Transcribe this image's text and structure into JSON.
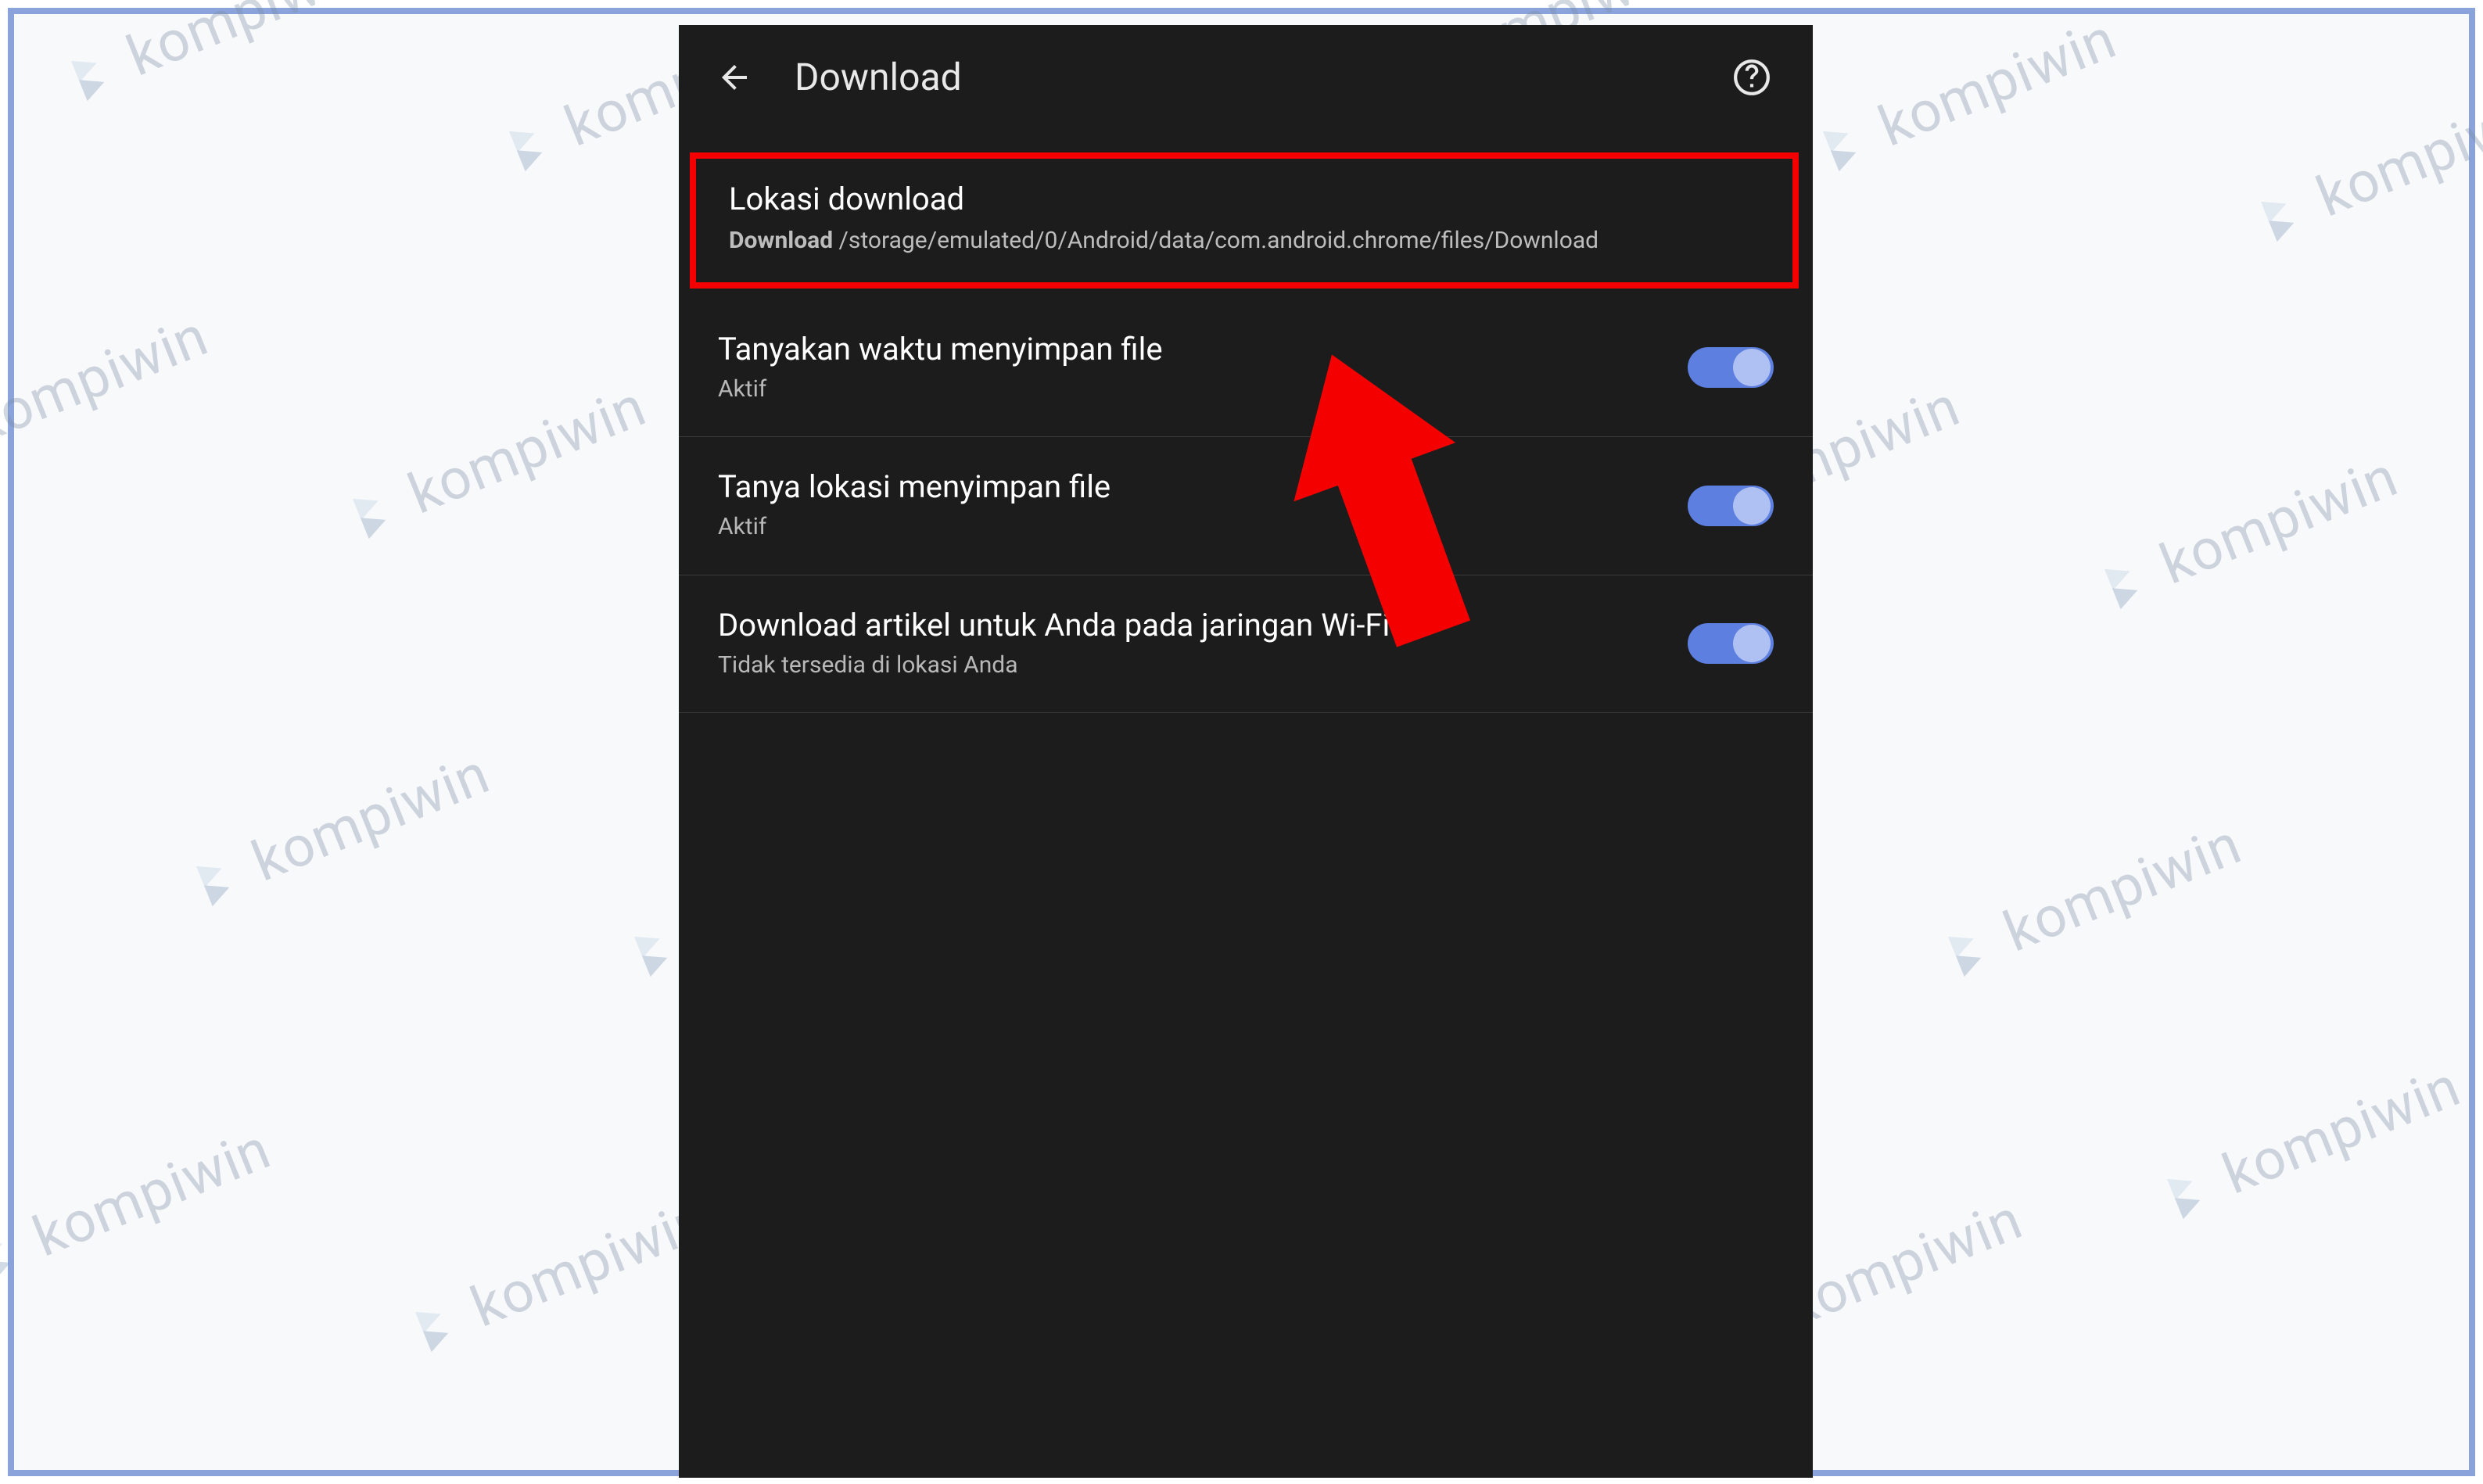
{
  "watermark_text": "kompiwin",
  "appbar": {
    "title": "Download"
  },
  "download_location": {
    "title": "Lokasi download",
    "path_label": "Download",
    "path_value": " /storage/emulated/0/Android/data/com.android.chrome/files/Download"
  },
  "settings": [
    {
      "title": "Tanyakan waktu menyimpan file",
      "subtitle": "Aktif",
      "enabled": true
    },
    {
      "title": "Tanya lokasi menyimpan file",
      "subtitle": "Aktif",
      "enabled": true
    },
    {
      "title": "Download artikel untuk Anda pada jaringan Wi-Fi",
      "subtitle": "Tidak tersedia di lokasi Anda",
      "enabled": true
    }
  ]
}
